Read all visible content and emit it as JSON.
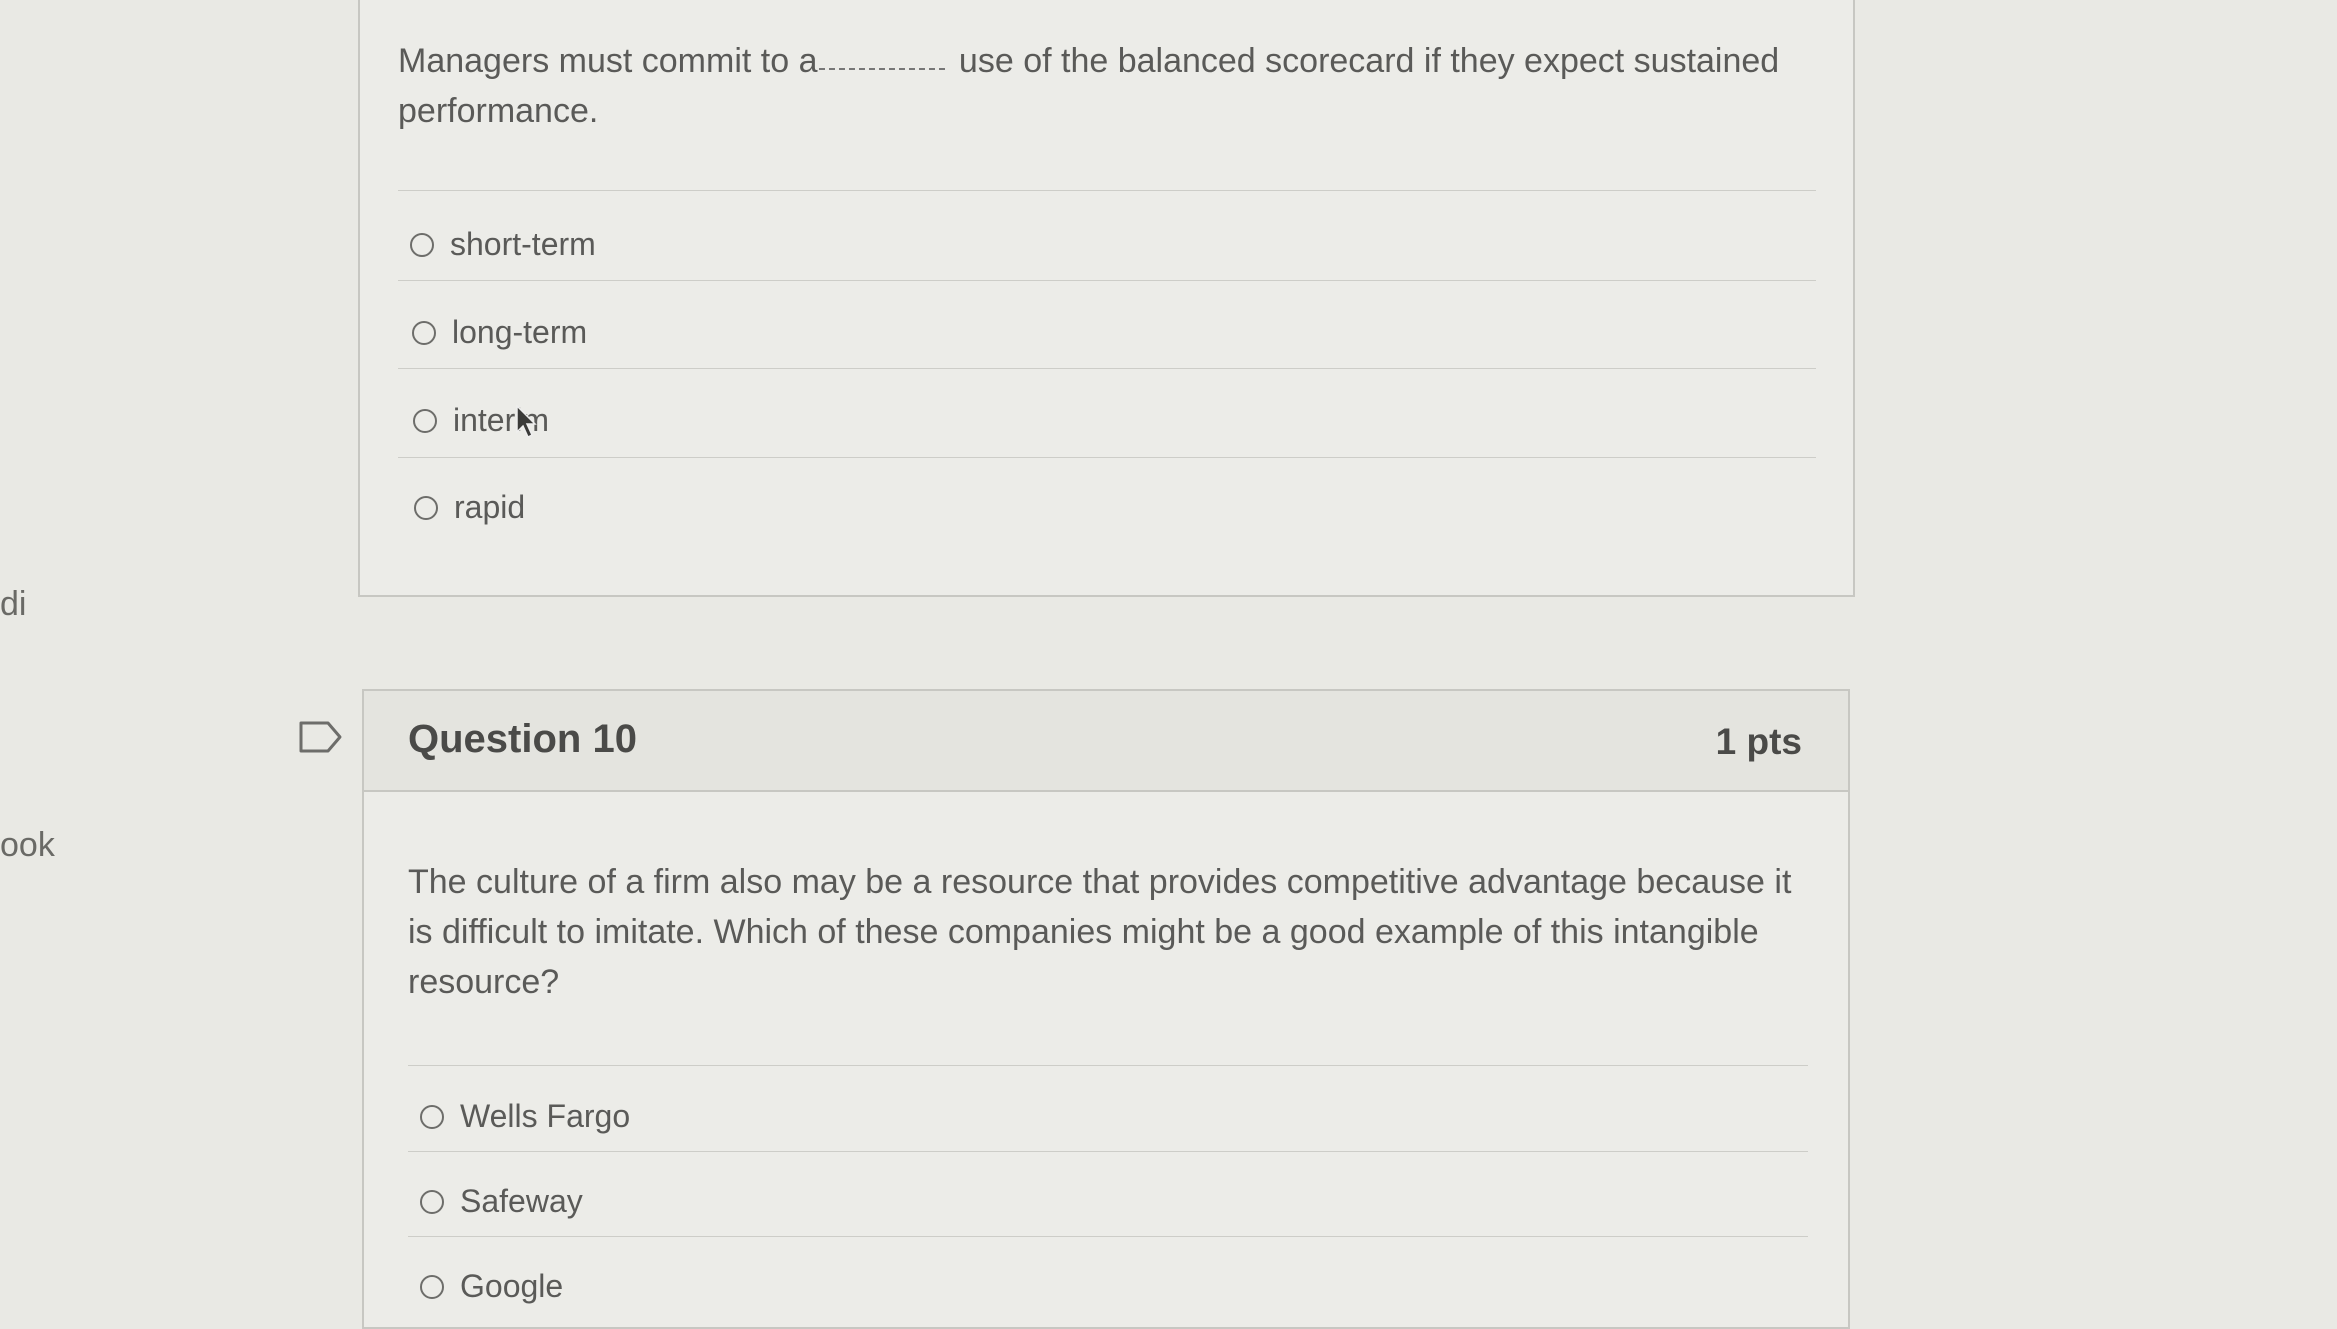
{
  "sidebar_fragments": [
    "di",
    "ook"
  ],
  "question9": {
    "text_before": "Managers must commit to a",
    "text_after": " use of the balanced scorecard if they expect sustained performance.",
    "options": [
      "short-term",
      "long-term",
      "interim",
      "rapid"
    ]
  },
  "question10": {
    "title": "Question 10",
    "points": "1 pts",
    "text": "The culture of a firm also may be a resource that provides competitive advantage because it is difficult to imitate. Which of these companies might be a good example of this intangible resource?",
    "options": [
      "Wells Fargo",
      "Safeway",
      "Google"
    ]
  },
  "icons": {
    "flag": "flag-outline-icon",
    "cursor": "mouse-pointer-icon",
    "radio": "radio-unselected-icon"
  }
}
